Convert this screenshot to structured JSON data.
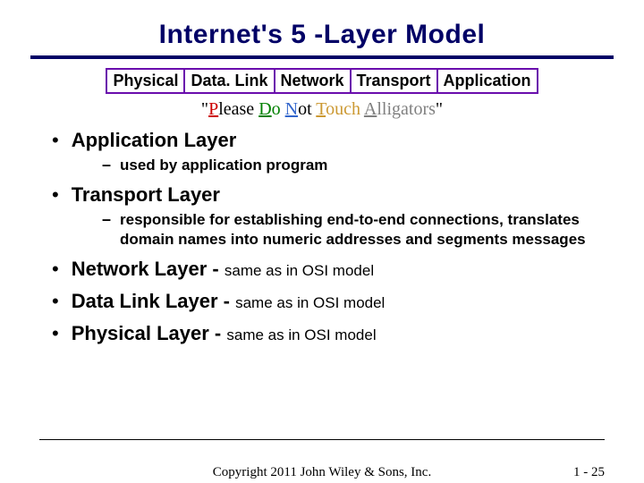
{
  "title": "Internet's 5 -Layer Model",
  "layers": [
    "Physical",
    "Data. Link",
    "Network",
    "Transport",
    "Application"
  ],
  "mnemonic": {
    "open_quote": "\"",
    "p_letter": "P",
    "p_rest": "lease ",
    "d_letter": "D",
    "d_rest": "o ",
    "n_letter": "N",
    "n_rest": "ot ",
    "t_letter": "T",
    "t_rest": "ouch ",
    "a_letter": "A",
    "a_rest": "lligators",
    "close_quote": "\""
  },
  "bullets": [
    {
      "label": "Application Layer",
      "append": "",
      "sub": "used by application program"
    },
    {
      "label": "Transport Layer",
      "append": "",
      "sub": "responsible for establishing end-to-end connections, translates domain names into numeric addresses and segments messages"
    },
    {
      "label": "Network Layer - ",
      "append": "same as in OSI model",
      "sub": ""
    },
    {
      "label": "Data Link Layer - ",
      "append": "same as in OSI model",
      "sub": ""
    },
    {
      "label": "Physical Layer - ",
      "append": "same as in OSI model",
      "sub": ""
    }
  ],
  "footer": {
    "copyright": "Copyright 2011 John Wiley & Sons, Inc.",
    "pageno": "1  -  25"
  }
}
